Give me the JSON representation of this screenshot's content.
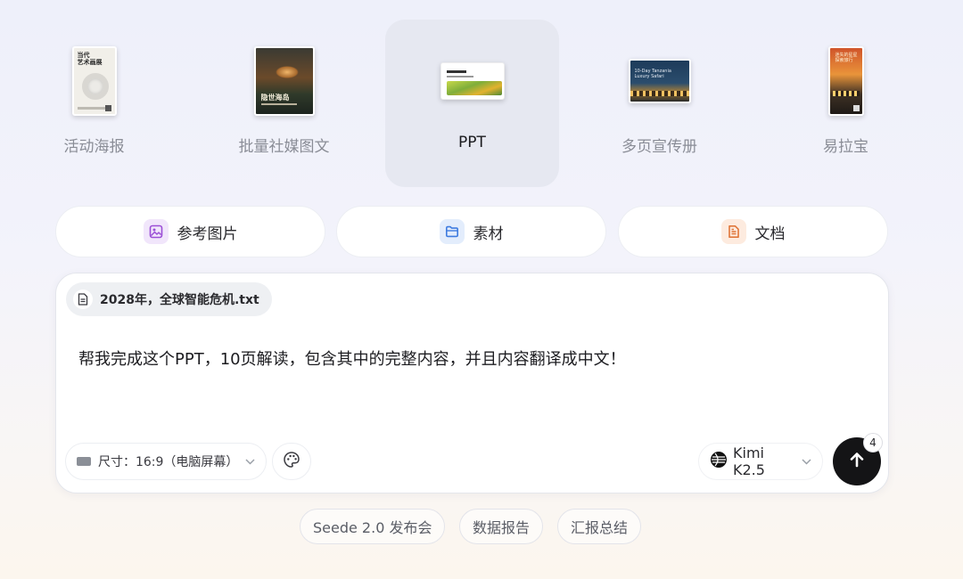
{
  "templates": [
    {
      "label": "活动海报",
      "thumb_text": "当代\n艺术画展",
      "active": false
    },
    {
      "label": "批量社媒图文",
      "thumb_text": "隐世海岛",
      "active": false
    },
    {
      "label": "PPT",
      "active": true
    },
    {
      "label": "多页宣传册",
      "thumb_text": "10-Day Tanzania Luxury Safari",
      "active": false
    },
    {
      "label": "易拉宝",
      "thumb_text": "迷失的星星 探索旅行",
      "active": false
    }
  ],
  "options": [
    {
      "label": "参考图片",
      "icon": "image-icon",
      "color": "#9b4fd6",
      "bg": "#f1e6fb"
    },
    {
      "label": "素材",
      "icon": "folder-icon",
      "color": "#3f7ce0",
      "bg": "#e3edfc"
    },
    {
      "label": "文档",
      "icon": "document-icon",
      "color": "#e0763a",
      "bg": "#fdebdf"
    }
  ],
  "composer": {
    "attachment": "2028年，全球智能危机.txt",
    "prompt": "帮我完成这个PPT，10页解读，包含其中的完整内容，并且内容翻译成中文！",
    "size_label": "尺寸：16:9（电脑屏幕）",
    "model": "Kimi K2.5",
    "send_badge": "4"
  },
  "suggestions": [
    "Seede 2.0 发布会",
    "数据报告",
    "汇报总结"
  ]
}
